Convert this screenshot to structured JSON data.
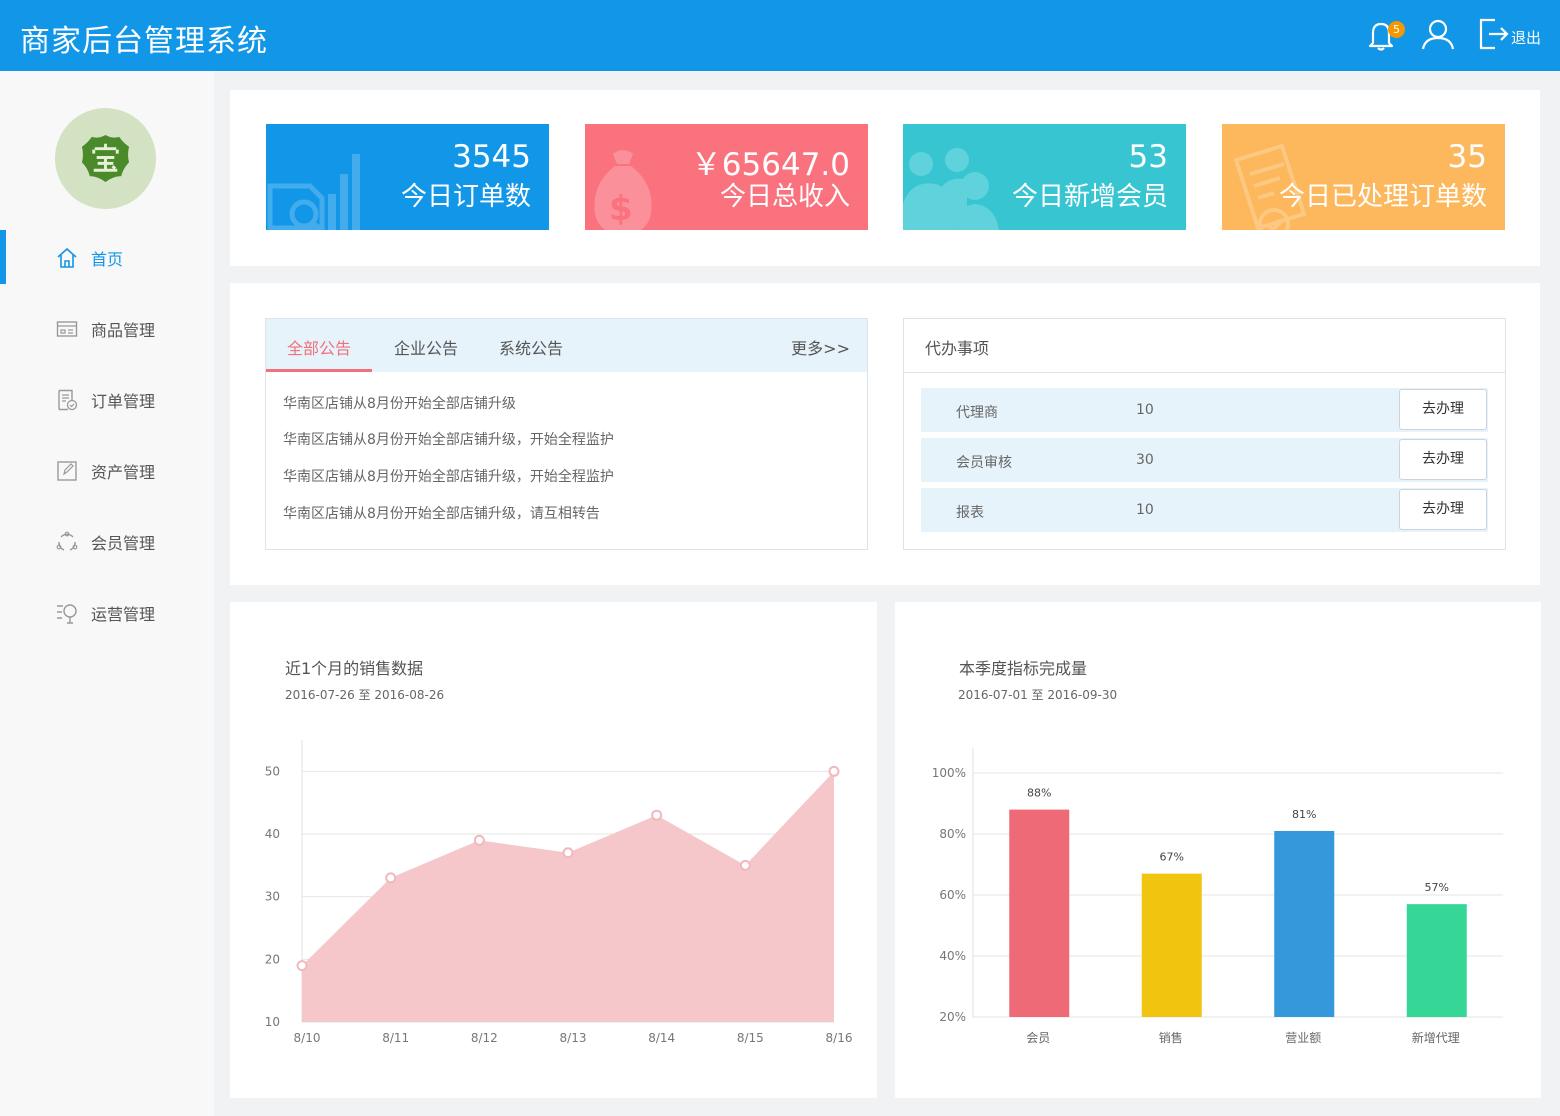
{
  "header": {
    "title": "商家后台管理系统",
    "notification_count": "5",
    "logout_label": "退出",
    "color": "#1296e8"
  },
  "sidebar": {
    "logo_icon": "treasure-seal-icon",
    "items": [
      {
        "label": "首页",
        "icon": "home-icon",
        "active": true
      },
      {
        "label": "商品管理",
        "icon": "product-card-icon"
      },
      {
        "label": "订单管理",
        "icon": "order-doc-icon"
      },
      {
        "label": "资产管理",
        "icon": "asset-edit-icon"
      },
      {
        "label": "会员管理",
        "icon": "member-circle-icon"
      },
      {
        "label": "运营管理",
        "icon": "operation-search-icon"
      }
    ]
  },
  "stats": [
    {
      "value": "3545",
      "label": "今日订单数",
      "color": "#1296e8"
    },
    {
      "value": "￥65647.0",
      "label": "今日总收入",
      "color": "#f9727e"
    },
    {
      "value": "53",
      "label": "今日新增会员",
      "color": "#37c5d2"
    },
    {
      "value": "35",
      "label": "今日已处理订单数",
      "color": "#fdb75c"
    }
  ],
  "announcements": {
    "tabs": [
      "全部公告",
      "企业公告",
      "系统公告"
    ],
    "more": "更多>>",
    "items": [
      "华南区店铺从8月份开始全部店铺升级",
      "华南区店铺从8月份开始全部店铺升级，开始全程监护",
      "华南区店铺从8月份开始全部店铺升级，开始全程监护",
      "华南区店铺从8月份开始全部店铺升级，请互相转告"
    ]
  },
  "todo": {
    "title": "代办事项",
    "rows": [
      {
        "name": "代理商",
        "count": "10",
        "action": "去办理"
      },
      {
        "name": "会员审核",
        "count": "30",
        "action": "去办理"
      },
      {
        "name": "报表",
        "count": "10",
        "action": "去办理"
      }
    ]
  },
  "sales_panel": {
    "title": "近1个月的销售数据",
    "date_range": "2016-07-26  至  2016-08-26"
  },
  "quota_panel": {
    "title": "本季度指标完成量",
    "date_range": "2016-07-01  至  2016-09-30"
  },
  "chart_data": [
    {
      "type": "area",
      "x": [
        "8/10",
        "8/11",
        "8/12",
        "8/13",
        "8/14",
        "8/15",
        "8/16"
      ],
      "values": [
        19,
        33,
        39,
        37,
        43,
        35,
        50
      ],
      "yticks": [
        10,
        20,
        30,
        40,
        50
      ],
      "ylim": [
        10,
        55
      ],
      "grid": true,
      "color": "#f6c7ca"
    },
    {
      "type": "bar",
      "categories": [
        "会员",
        "销售",
        "营业额",
        "新增代理"
      ],
      "values": [
        88,
        67,
        81,
        57
      ],
      "value_labels": [
        "88%",
        "67%",
        "81%",
        "57%"
      ],
      "colors": [
        "#ef6a77",
        "#f1c40f",
        "#3498db",
        "#36d697"
      ],
      "yticks": [
        "20%",
        "40%",
        "60%",
        "80%",
        "100%"
      ],
      "ylim": [
        20,
        100
      ],
      "grid": true
    }
  ]
}
